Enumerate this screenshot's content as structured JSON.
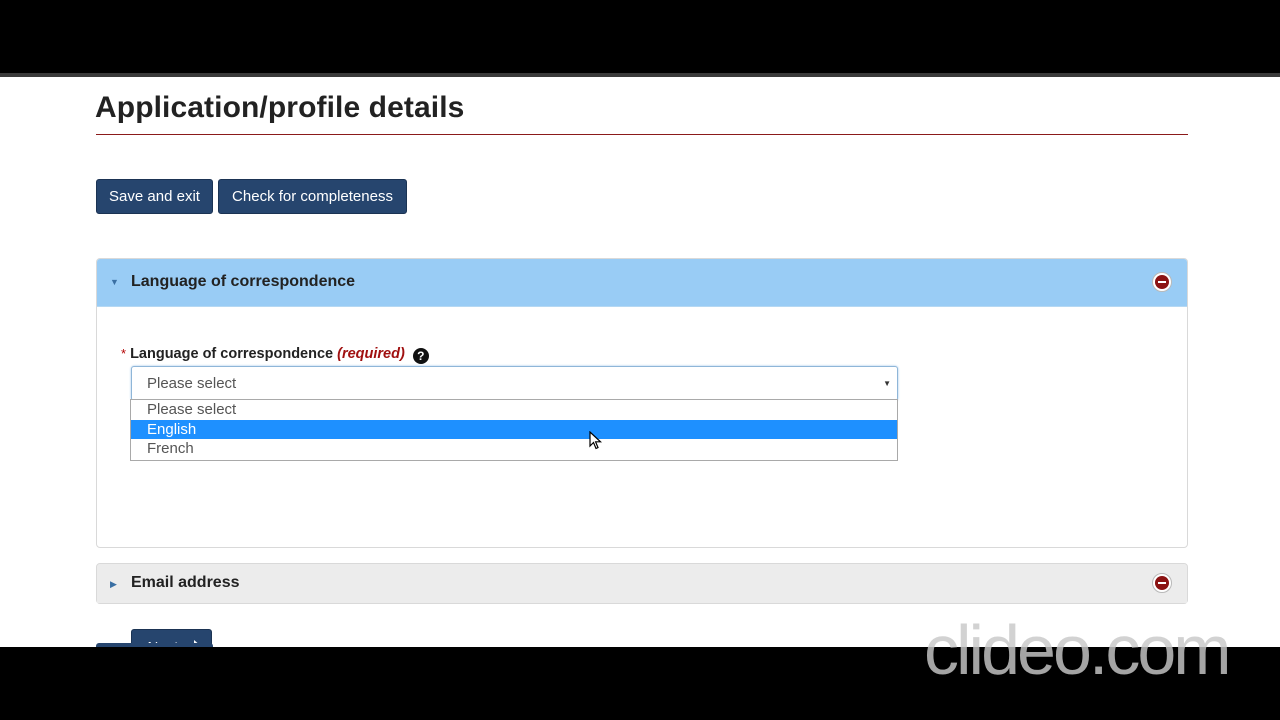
{
  "page": {
    "title": "Application/profile details"
  },
  "toolbar": {
    "save_exit_label": "Save and exit",
    "check_label": "Check for completeness"
  },
  "sections": {
    "language": {
      "title": "Language of correspondence",
      "expanded": true,
      "field_label": "Language of correspondence",
      "required_text": "(required)",
      "required_marker": "*",
      "help_icon": "?",
      "select_value": "Please select",
      "options": [
        "Please select",
        "English",
        "French"
      ],
      "highlighted_option": "English",
      "next_label": "Next"
    },
    "email": {
      "title": "Email address",
      "expanded": false
    }
  },
  "watermark": "clideo.com",
  "colors": {
    "primary_button": "#26456e",
    "panel_header_active": "#99ccf5",
    "panel_header_inactive": "#ececec",
    "remove_icon": "#8b1313",
    "highlight_option": "#1e90ff"
  }
}
